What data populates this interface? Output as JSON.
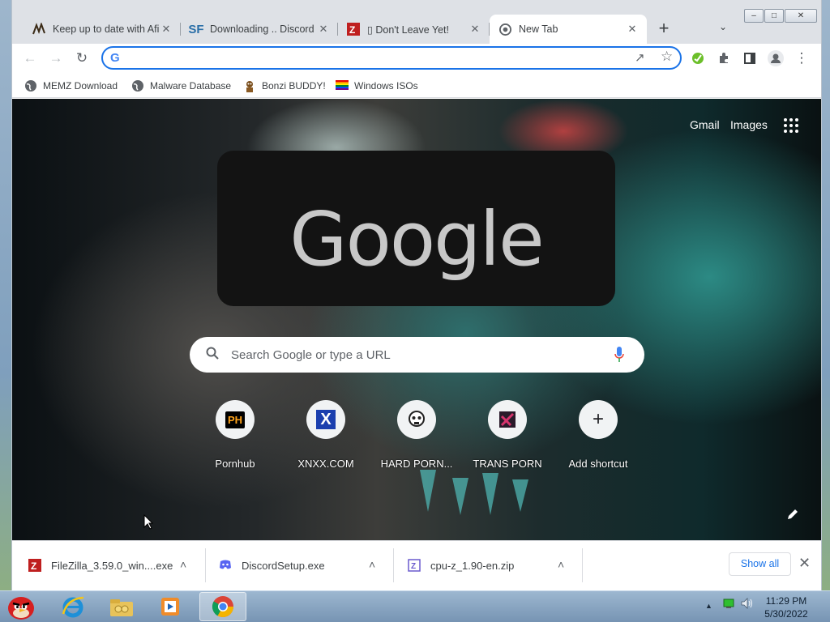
{
  "tabs": [
    {
      "title": "Keep up to date with Afi",
      "favicon": "scribble-icon"
    },
    {
      "title": "Downloading .. Discord",
      "favicon": "sourceforge-icon"
    },
    {
      "title": "▯ Don't Leave Yet!",
      "favicon": "filezilla-icon"
    },
    {
      "title": "New Tab",
      "favicon": "chrome-icon"
    }
  ],
  "newtab_glyph": "+",
  "tabs_menu_glyph": "⌄",
  "window_controls": {
    "minimize": "–",
    "maximize": "□",
    "close": "✕"
  },
  "toolbar": {
    "back": "←",
    "forward": "→",
    "reload": "↻",
    "omnibox_value": "",
    "omnibox_icon": "G",
    "share": "↗",
    "star": "☆",
    "menu": "⋮"
  },
  "bookmarks": [
    {
      "label": "MEMZ Download",
      "icon": "globe-icon"
    },
    {
      "label": "Malware Database",
      "icon": "globe-icon"
    },
    {
      "label": "Bonzi BUDDY!",
      "icon": "bonzi-icon"
    },
    {
      "label": "Windows ISOs",
      "icon": "rainbow-flag-icon"
    }
  ],
  "ntp": {
    "gmail": "Gmail",
    "images": "Images",
    "logo": "Google",
    "search_placeholder": "Search Google or type a URL",
    "shortcuts": [
      {
        "label": "Pornhub",
        "icon_text": "PH"
      },
      {
        "label": "XNXX.COM",
        "icon_text": "X"
      },
      {
        "label": "HARD PORN...",
        "icon_text": ""
      },
      {
        "label": "TRANS PORN",
        "icon_text": ""
      },
      {
        "label": "Add shortcut",
        "icon_text": "+"
      }
    ]
  },
  "downloads": [
    {
      "name": "FileZilla_3.59.0_win....exe",
      "icon": "filezilla-icon"
    },
    {
      "name": "DiscordSetup.exe",
      "icon": "discord-icon"
    },
    {
      "name": "cpu-z_1.90-en.zip",
      "icon": "zip-icon"
    }
  ],
  "download_chevron": "˄",
  "show_all": "Show all",
  "shelf_close": "✕",
  "taskbar": {
    "apps": [
      "angry-birds-icon",
      "internet-explorer-icon",
      "libraries-folder-icon",
      "media-player-icon",
      "chrome-icon"
    ],
    "tray_arrow": "▲",
    "time": "11:29 PM",
    "date": "5/30/2022"
  }
}
